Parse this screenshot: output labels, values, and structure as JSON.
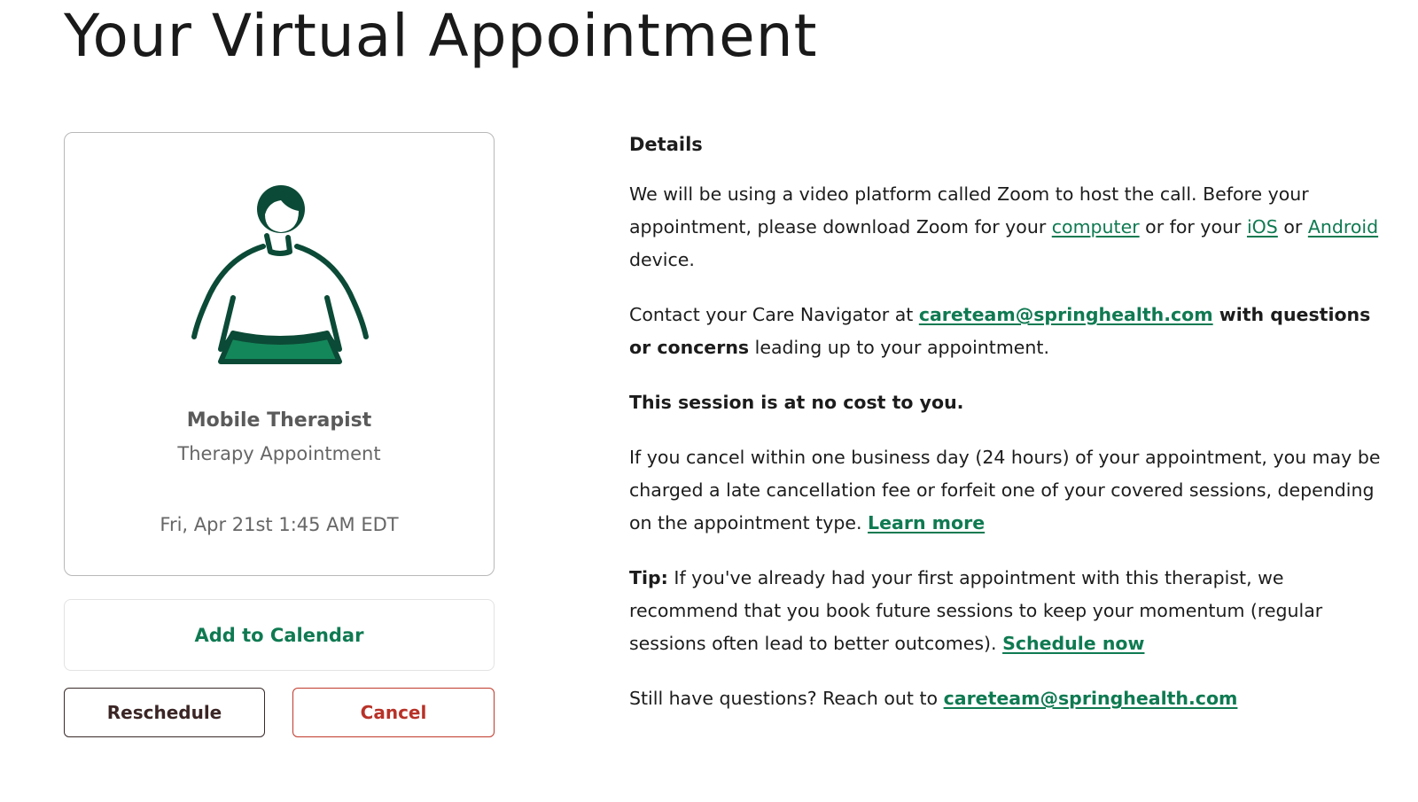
{
  "page": {
    "title": "Your Virtual Appointment"
  },
  "appointment_card": {
    "illustration_icon": "therapist-person-icon",
    "provider_name": "Mobile Therapist",
    "appointment_type": "Therapy Appointment",
    "datetime": "Fri, Apr 21st 1:45 AM EDT"
  },
  "actions": {
    "add_to_calendar": "Add to Calendar",
    "reschedule": "Reschedule",
    "cancel": "Cancel"
  },
  "details": {
    "heading": "Details",
    "zoom": {
      "text_before": "We will be using a video platform called Zoom to host the call. Before your appointment, please download Zoom for your ",
      "link_computer": "computer",
      "text_mid1": " or for your ",
      "link_ios": "iOS",
      "text_mid2": " or ",
      "link_android": "Android",
      "text_after": " device."
    },
    "contact": {
      "text_before": "Contact your Care Navigator at ",
      "email_link": "careteam@springhealth.com",
      "bold_text": " with questions or concerns",
      "text_after": " leading up to your appointment."
    },
    "no_cost": "This session is at no cost to you.",
    "cancellation": {
      "text": "If you cancel within one business day (24 hours) of your appointment, you may be charged a late cancellation fee or forfeit one of your covered sessions, depending on the appointment type. ",
      "link": "Learn more"
    },
    "tip": {
      "label": "Tip:",
      "text": " If you've already had your first appointment with this therapist, we recommend that you book future sessions to keep your momentum (regular sessions often lead to better outcomes). ",
      "link": "Schedule now"
    },
    "questions": {
      "text": "Still have questions? Reach out to ",
      "email_link": "careteam@springhealth.com"
    }
  },
  "colors": {
    "accent_green": "#0f7a52",
    "dark_green": "#0b4a36",
    "cancel_red": "#b83228",
    "card_border": "#b8b8b8"
  }
}
